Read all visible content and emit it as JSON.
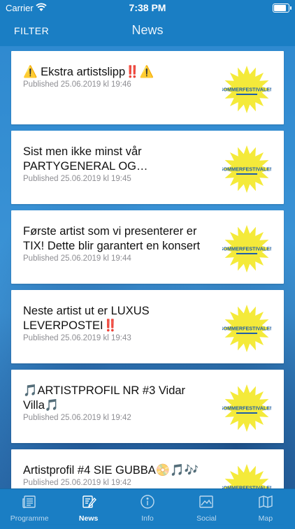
{
  "status_bar": {
    "carrier": "Carrier",
    "time": "7:38 PM"
  },
  "nav": {
    "filter_label": "FILTER",
    "title": "News"
  },
  "logo_text": "SOMMERFESTIVALEN",
  "news": [
    {
      "headline": "⚠️ Ekstra artistslipp‼️⚠️",
      "published": "Published 25.06.2019 kl 19:46"
    },
    {
      "headline": "Sist men ikke minst vår PARTYGENERAL OG KONFERANSIER",
      "published": "Published 25.06.2019 kl 19:45"
    },
    {
      "headline": "Første artist som vi presenterer er TIX! Dette blir garantert en konsert",
      "published": "Published 25.06.2019 kl 19:44"
    },
    {
      "headline": "Neste artist ut er LUXUS LEVERPOSTEI‼️",
      "published": "Published 25.06.2019 kl 19:43"
    },
    {
      "headline": "🎵ARTISTPROFIL NR #3 Vidar Villa🎵",
      "published": "Published 25.06.2019 kl 19:42"
    },
    {
      "headline": "Artistprofil #4 SIE GUBBA📀🎵🎶",
      "published": "Published 25.06.2019 kl 19:42"
    }
  ],
  "tabs": [
    {
      "label": "Programme",
      "icon": "newspaper-icon",
      "active": false
    },
    {
      "label": "News",
      "icon": "edit-note-icon",
      "active": true
    },
    {
      "label": "Info",
      "icon": "info-icon",
      "active": false
    },
    {
      "label": "Social",
      "icon": "image-icon",
      "active": false
    },
    {
      "label": "Map",
      "icon": "map-icon",
      "active": false
    }
  ],
  "colors": {
    "primary": "#1a7ec4",
    "logo_yellow": "#f4ea3a",
    "logo_blue": "#1f5fa8"
  }
}
